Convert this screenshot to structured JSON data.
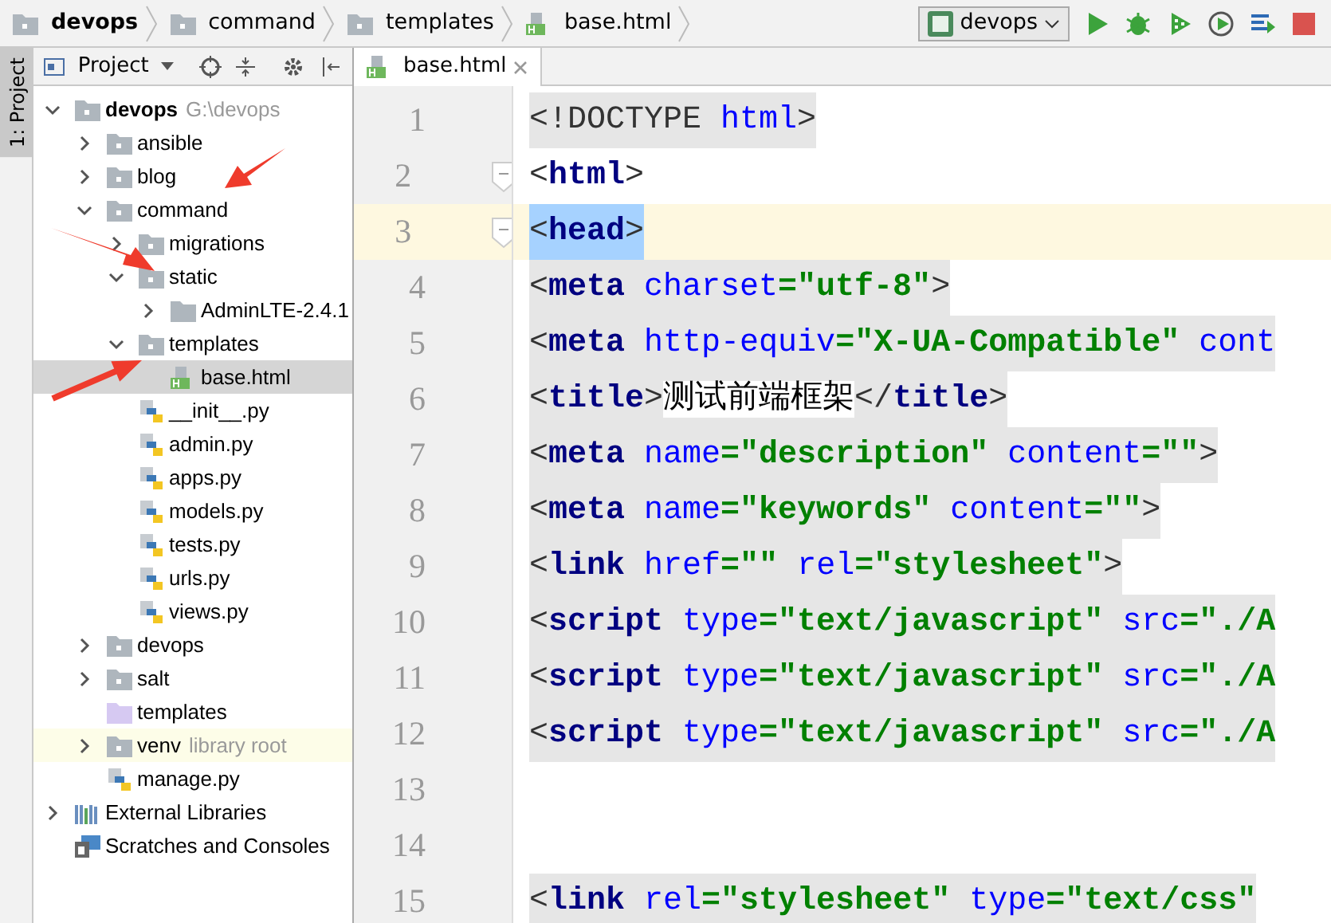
{
  "breadcrumbs": [
    {
      "label": "devops",
      "kind": "folder",
      "bold": true
    },
    {
      "label": "command",
      "kind": "folder",
      "bold": false
    },
    {
      "label": "templates",
      "kind": "folder",
      "bold": false
    },
    {
      "label": "base.html",
      "kind": "html",
      "bold": false
    }
  ],
  "run_config": {
    "label": "devops"
  },
  "side_strip": {
    "label": "1: Project"
  },
  "project_panel": {
    "title": "Project"
  },
  "editor_tabs": [
    {
      "label": "base.html",
      "selected": true
    }
  ],
  "tree": [
    {
      "label": "devops",
      "hint": "G:\\devops",
      "kind": "folder",
      "bold": true,
      "expanded": true,
      "selected": false,
      "children": [
        {
          "label": "ansible",
          "kind": "folder",
          "expanded": false,
          "selected": false
        },
        {
          "label": "blog",
          "kind": "folder",
          "expanded": false,
          "selected": false
        },
        {
          "label": "command",
          "kind": "folder",
          "expanded": true,
          "selected": false,
          "children": [
            {
              "label": "migrations",
              "kind": "folder",
              "expanded": false,
              "selected": false
            },
            {
              "label": "static",
              "kind": "folder",
              "expanded": true,
              "selected": false,
              "children": [
                {
                  "label": "AdminLTE-2.4.1",
                  "kind": "plain-folder",
                  "expanded": false,
                  "selected": false
                }
              ]
            },
            {
              "label": "templates",
              "kind": "folder",
              "expanded": true,
              "selected": false,
              "children": [
                {
                  "label": "base.html",
                  "kind": "html",
                  "selected": true
                }
              ]
            },
            {
              "label": "__init__.py",
              "kind": "python",
              "selected": false
            },
            {
              "label": "admin.py",
              "kind": "python",
              "selected": false
            },
            {
              "label": "apps.py",
              "kind": "python",
              "selected": false
            },
            {
              "label": "models.py",
              "kind": "python",
              "selected": false
            },
            {
              "label": "tests.py",
              "kind": "python",
              "selected": false
            },
            {
              "label": "urls.py",
              "kind": "python",
              "selected": false
            },
            {
              "label": "views.py",
              "kind": "python",
              "selected": false
            }
          ]
        },
        {
          "label": "devops",
          "kind": "folder",
          "expanded": false,
          "selected": false
        },
        {
          "label": "salt",
          "kind": "folder",
          "expanded": false,
          "selected": false
        },
        {
          "label": "templates",
          "kind": "template-folder",
          "selected": false
        },
        {
          "label": "venv",
          "hint": "library root",
          "kind": "library-folder",
          "expanded": false,
          "selected": false
        },
        {
          "label": "manage.py",
          "kind": "python",
          "selected": false
        }
      ]
    },
    {
      "label": "External Libraries",
      "kind": "libraries",
      "expanded": false,
      "selected": false
    },
    {
      "label": "Scratches and Consoles",
      "kind": "scratches",
      "selected": false
    }
  ],
  "code_lines": [
    {
      "number": "1",
      "shaded": true,
      "current": false,
      "selected": false,
      "fold_marker": false,
      "tokens": [
        {
          "kind": "punct",
          "text": "<!DOCTYPE "
        },
        {
          "kind": "attr",
          "text": "html"
        },
        {
          "kind": "punct",
          "text": ">"
        }
      ]
    },
    {
      "number": "2",
      "shaded": false,
      "current": false,
      "selected": false,
      "fold_marker": true,
      "tokens": [
        {
          "kind": "punct",
          "text": "<"
        },
        {
          "kind": "tag",
          "text": "html"
        },
        {
          "kind": "punct",
          "text": ">"
        }
      ]
    },
    {
      "number": "3",
      "current": true,
      "selected": true,
      "fold_marker": true,
      "tokens": [
        {
          "kind": "punct",
          "text": "<"
        },
        {
          "kind": "tag",
          "text": "head"
        },
        {
          "kind": "punct",
          "text": ">"
        }
      ]
    },
    {
      "number": "4",
      "shaded": true,
      "current": false,
      "selected": false,
      "fold_marker": false,
      "tokens": [
        {
          "kind": "punct",
          "text": "<"
        },
        {
          "kind": "tag",
          "text": "meta "
        },
        {
          "kind": "attr",
          "text": "charset"
        },
        {
          "kind": "value",
          "text": "=\"utf-8\""
        },
        {
          "kind": "punct",
          "text": ">"
        }
      ]
    },
    {
      "number": "5",
      "shaded": true,
      "current": false,
      "selected": false,
      "fold_marker": false,
      "tokens": [
        {
          "kind": "punct",
          "text": "<"
        },
        {
          "kind": "tag",
          "text": "meta "
        },
        {
          "kind": "attr",
          "text": "http-equiv"
        },
        {
          "kind": "value",
          "text": "=\"X-UA-Compatible\" "
        },
        {
          "kind": "attr",
          "text": "cont"
        }
      ]
    },
    {
      "number": "6",
      "shaded": true,
      "current": false,
      "selected": false,
      "fold_marker": false,
      "tokens": [
        {
          "kind": "punct",
          "text": "<"
        },
        {
          "kind": "tag",
          "text": "title"
        },
        {
          "kind": "punct",
          "text": ">"
        },
        {
          "kind": "text",
          "text": "测试前端框架"
        },
        {
          "kind": "punct",
          "text": "</"
        },
        {
          "kind": "tag",
          "text": "title"
        },
        {
          "kind": "punct",
          "text": ">"
        }
      ]
    },
    {
      "number": "7",
      "shaded": true,
      "current": false,
      "selected": false,
      "fold_marker": false,
      "tokens": [
        {
          "kind": "punct",
          "text": "<"
        },
        {
          "kind": "tag",
          "text": "meta "
        },
        {
          "kind": "attr",
          "text": "name"
        },
        {
          "kind": "value",
          "text": "=\"description\" "
        },
        {
          "kind": "attr",
          "text": "content"
        },
        {
          "kind": "value",
          "text": "=\"\""
        },
        {
          "kind": "punct",
          "text": ">"
        }
      ]
    },
    {
      "number": "8",
      "shaded": true,
      "current": false,
      "selected": false,
      "fold_marker": false,
      "tokens": [
        {
          "kind": "punct",
          "text": "<"
        },
        {
          "kind": "tag",
          "text": "meta "
        },
        {
          "kind": "attr",
          "text": "name"
        },
        {
          "kind": "value",
          "text": "=\"keywords\" "
        },
        {
          "kind": "attr",
          "text": "content"
        },
        {
          "kind": "value",
          "text": "=\"\""
        },
        {
          "kind": "punct",
          "text": ">"
        }
      ]
    },
    {
      "number": "9",
      "shaded": true,
      "current": false,
      "selected": false,
      "fold_marker": false,
      "tokens": [
        {
          "kind": "punct",
          "text": "<"
        },
        {
          "kind": "tag",
          "text": "link "
        },
        {
          "kind": "attr",
          "text": "href"
        },
        {
          "kind": "value",
          "text": "=\"\" "
        },
        {
          "kind": "attr",
          "text": "rel"
        },
        {
          "kind": "value",
          "text": "=\"stylesheet\""
        },
        {
          "kind": "punct",
          "text": ">"
        }
      ]
    },
    {
      "number": "10",
      "shaded": true,
      "current": false,
      "selected": false,
      "fold_marker": false,
      "tokens": [
        {
          "kind": "punct",
          "text": "<"
        },
        {
          "kind": "tag",
          "text": "script "
        },
        {
          "kind": "attr",
          "text": "type"
        },
        {
          "kind": "value",
          "text": "=\"text/javascript\" "
        },
        {
          "kind": "attr",
          "text": "src"
        },
        {
          "kind": "value",
          "text": "=\"./A"
        }
      ]
    },
    {
      "number": "11",
      "shaded": true,
      "current": false,
      "selected": false,
      "fold_marker": false,
      "tokens": [
        {
          "kind": "punct",
          "text": "<"
        },
        {
          "kind": "tag",
          "text": "script "
        },
        {
          "kind": "attr",
          "text": "type"
        },
        {
          "kind": "value",
          "text": "=\"text/javascript\" "
        },
        {
          "kind": "attr",
          "text": "src"
        },
        {
          "kind": "value",
          "text": "=\"./A"
        }
      ]
    },
    {
      "number": "12",
      "shaded": true,
      "current": false,
      "selected": false,
      "fold_marker": false,
      "tokens": [
        {
          "kind": "punct",
          "text": "<"
        },
        {
          "kind": "tag",
          "text": "script "
        },
        {
          "kind": "attr",
          "text": "type"
        },
        {
          "kind": "value",
          "text": "=\"text/javascript\" "
        },
        {
          "kind": "attr",
          "text": "src"
        },
        {
          "kind": "value",
          "text": "=\"./A"
        }
      ]
    },
    {
      "number": "13",
      "current": false,
      "fold_marker": false
    },
    {
      "number": "14",
      "current": false,
      "fold_marker": false
    },
    {
      "number": "15",
      "shaded": true,
      "current": false,
      "selected": false,
      "fold_marker": false,
      "tokens": [
        {
          "kind": "punct",
          "text": "<"
        },
        {
          "kind": "tag",
          "text": "link "
        },
        {
          "kind": "attr",
          "text": "rel"
        },
        {
          "kind": "value",
          "text": "=\"stylesheet\" "
        },
        {
          "kind": "attr",
          "text": "type"
        },
        {
          "kind": "value",
          "text": "=\"text/css\""
        }
      ]
    }
  ]
}
